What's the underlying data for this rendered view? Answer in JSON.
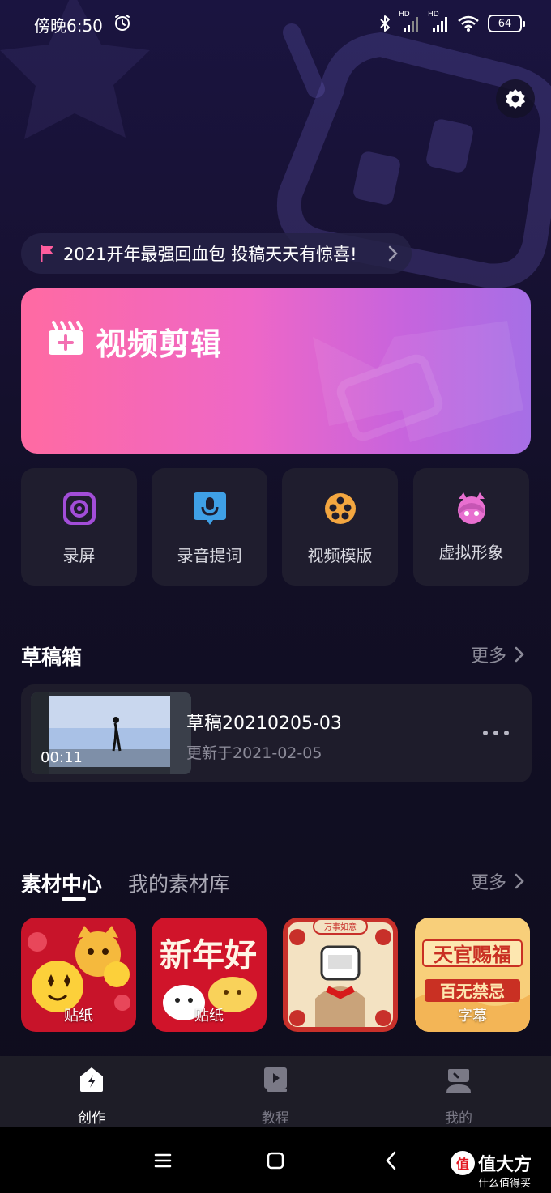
{
  "status_bar": {
    "time": "傍晚6:50",
    "battery": "64",
    "hd1": "HD",
    "hd2": "HD"
  },
  "promo": {
    "text": "2021开年最强回血包 投稿天天有惊喜!"
  },
  "hero": {
    "title": "视频剪辑"
  },
  "tools": [
    {
      "label": "录屏",
      "icon": "screen-record-icon"
    },
    {
      "label": "录音提词",
      "icon": "voice-prompt-icon"
    },
    {
      "label": "视频模版",
      "icon": "film-reel-icon"
    },
    {
      "label": "虚拟形象",
      "icon": "avatar-icon"
    }
  ],
  "drafts": {
    "title": "草稿箱",
    "more": "更多",
    "items": [
      {
        "name": "草稿20210205-03",
        "updated": "更新于2021-02-05",
        "duration": "00:11"
      }
    ]
  },
  "materials": {
    "tab_center": "素材中心",
    "tab_library": "我的素材库",
    "more": "更多",
    "items": [
      {
        "label": "贴纸"
      },
      {
        "label": "贴纸"
      },
      {
        "label": ""
      },
      {
        "label": "字幕"
      }
    ],
    "art_text": {
      "card2": "新年好",
      "card3_top": "万事如意",
      "card4_line1": "天官赐福",
      "card4_line2": "百无禁忌"
    }
  },
  "bottom_nav": [
    {
      "label": "创作",
      "active": true
    },
    {
      "label": "教程",
      "active": false
    },
    {
      "label": "我的",
      "active": false
    }
  ],
  "watermark": {
    "logo": "值",
    "main": "什么值得买",
    "short": "值大方"
  },
  "colors": {
    "hero_start": "#ff6aa2",
    "hero_end": "#a66fe6",
    "background": "#0f0d1f",
    "card": "#1f1d2e",
    "accent_pink": "#ff5c9d"
  }
}
